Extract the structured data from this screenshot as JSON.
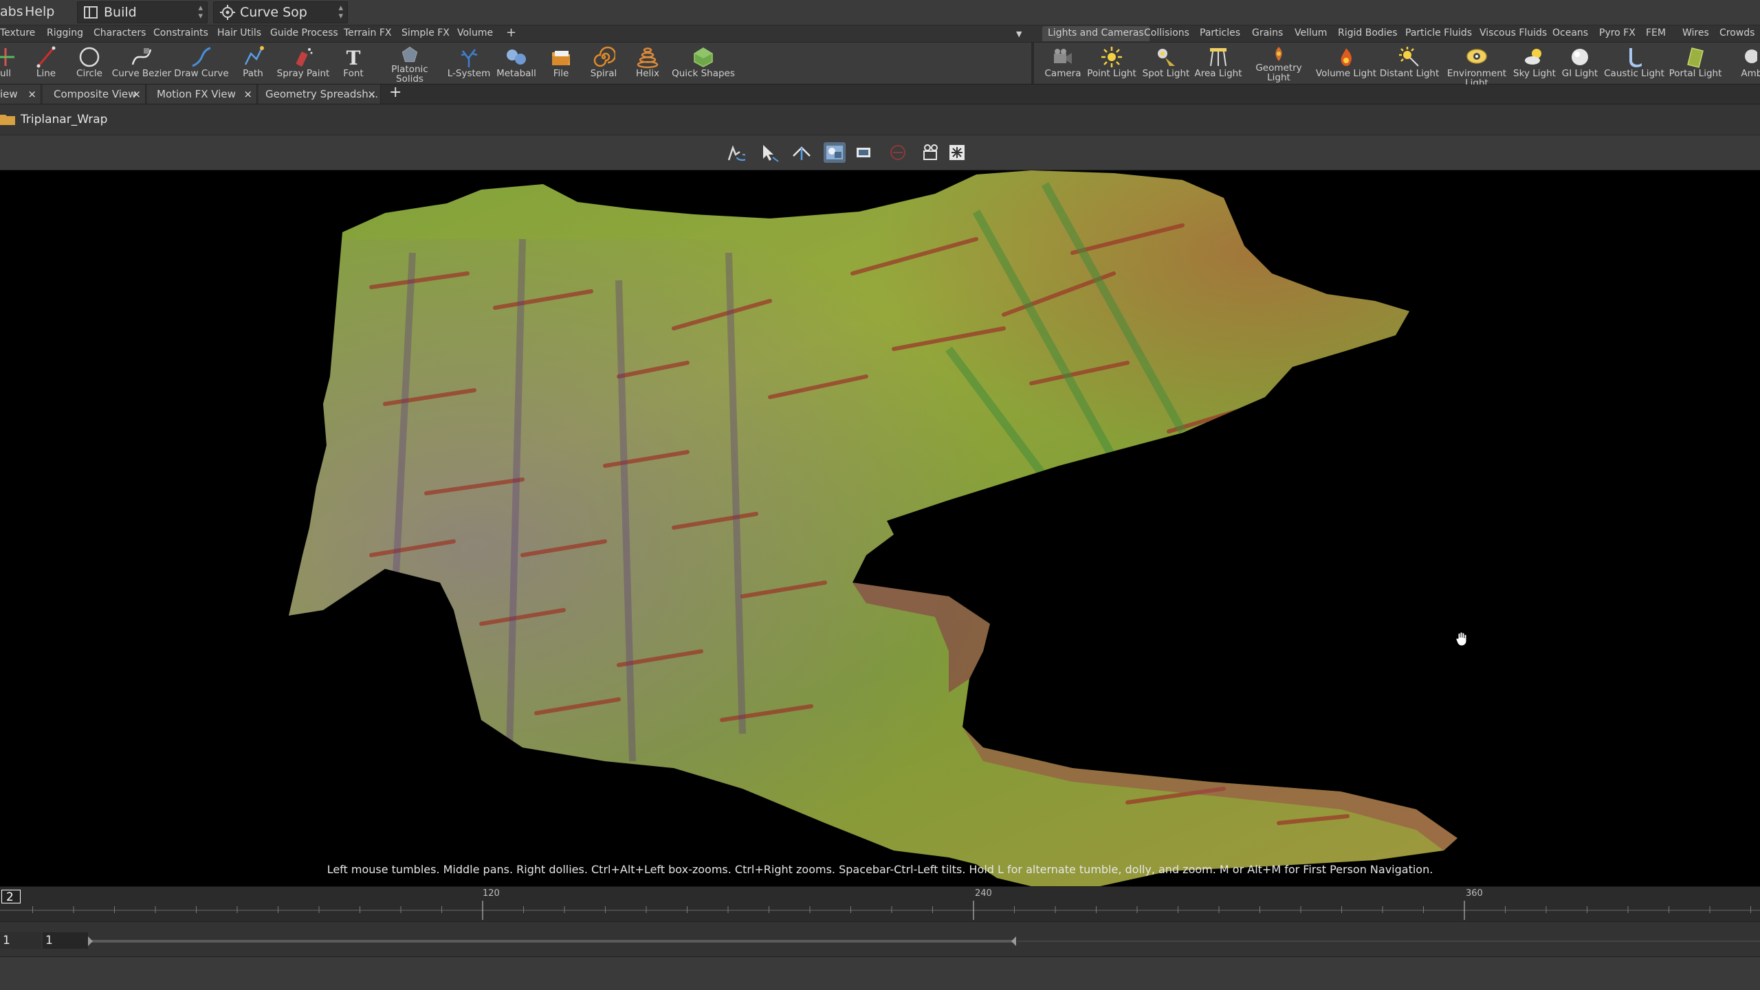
{
  "menubar": {
    "tabs_partial": "abs",
    "help": "Help"
  },
  "desktop": {
    "label": "Build"
  },
  "context": {
    "label": "Curve Sop"
  },
  "shelf_tabs_left": [
    "Texture",
    "Rigging",
    "Characters",
    "Constraints",
    "Hair Utils",
    "Guide Process",
    "Terrain FX",
    "Simple FX",
    "Volume"
  ],
  "shelf_tabs_right": [
    "Lights and Cameras",
    "Collisions",
    "Particles",
    "Grains",
    "Vellum",
    "Rigid Bodies",
    "Particle Fluids",
    "Viscous Fluids",
    "Oceans",
    "Pyro FX",
    "FEM",
    "Wires",
    "Crowds"
  ],
  "tools_left": [
    {
      "label": "ull",
      "icon": "null-icon"
    },
    {
      "label": "Line",
      "icon": "line-icon"
    },
    {
      "label": "Circle",
      "icon": "circle-icon"
    },
    {
      "label": "Curve Bezier",
      "icon": "curve-bezier-icon"
    },
    {
      "label": "Draw Curve",
      "icon": "draw-curve-icon"
    },
    {
      "label": "Path",
      "icon": "path-icon"
    },
    {
      "label": "Spray Paint",
      "icon": "spray-paint-icon"
    },
    {
      "label": "Font",
      "icon": "font-icon"
    },
    {
      "label": "Platonic\nSolids",
      "icon": "platonic-solids-icon"
    },
    {
      "label": "L-System",
      "icon": "l-system-icon"
    },
    {
      "label": "Metaball",
      "icon": "metaball-icon"
    },
    {
      "label": "File",
      "icon": "file-icon"
    },
    {
      "label": "Spiral",
      "icon": "spiral-icon"
    },
    {
      "label": "Helix",
      "icon": "helix-icon"
    },
    {
      "label": "Quick Shapes",
      "icon": "quick-shapes-icon"
    }
  ],
  "tools_right": [
    {
      "label": "Camera",
      "icon": "camera-icon"
    },
    {
      "label": "Point Light",
      "icon": "point-light-icon"
    },
    {
      "label": "Spot Light",
      "icon": "spot-light-icon"
    },
    {
      "label": "Area Light",
      "icon": "area-light-icon"
    },
    {
      "label": "Geometry\nLight",
      "icon": "geometry-light-icon"
    },
    {
      "label": "Volume Light",
      "icon": "volume-light-icon"
    },
    {
      "label": "Distant Light",
      "icon": "distant-light-icon"
    },
    {
      "label": "Environment\nLight",
      "icon": "environment-light-icon"
    },
    {
      "label": "Sky Light",
      "icon": "sky-light-icon"
    },
    {
      "label": "GI Light",
      "icon": "gi-light-icon"
    },
    {
      "label": "Caustic Light",
      "icon": "caustic-light-icon"
    },
    {
      "label": "Portal Light",
      "icon": "portal-light-icon"
    },
    {
      "label": "Ambien",
      "icon": "ambient-light-icon"
    }
  ],
  "pane_tabs": [
    "iew",
    "Composite View",
    "Motion FX View",
    "Geometry Spreadsh..."
  ],
  "path": {
    "node": "Triplanar_Wrap"
  },
  "viewport": {
    "hint": "Left mouse tumbles. Middle pans. Right dollies. Ctrl+Alt+Left box-zooms. Ctrl+Right zooms. Spacebar-Ctrl-Left tilts. Hold L for alternate tumble, dolly, and zoom. M or Alt+M for First Person Navigation."
  },
  "timeline": {
    "current_frame": "2",
    "markers": [
      "120",
      "240",
      "360"
    ]
  },
  "range": {
    "start": "1",
    "start2": "1"
  }
}
